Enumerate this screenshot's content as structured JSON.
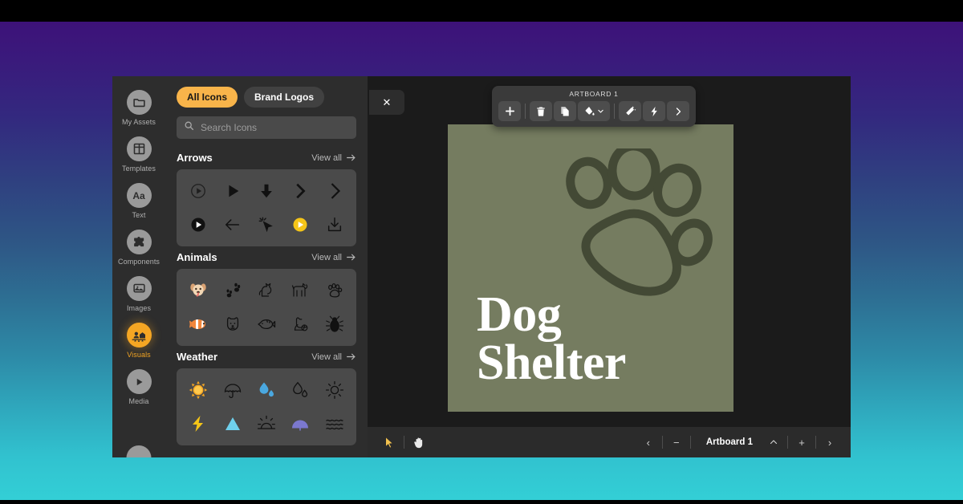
{
  "backdrop": {
    "gradient_top": "#3d1279",
    "gradient_bottom": "#33cfd6",
    "letterbox_color": "#000000"
  },
  "sidebar": {
    "items": [
      {
        "label": "My Assets",
        "icon": "folder-icon",
        "active": false
      },
      {
        "label": "Templates",
        "icon": "grid-layout-icon",
        "active": false
      },
      {
        "label": "Text",
        "icon": "text-aa-icon",
        "active": false
      },
      {
        "label": "Components",
        "icon": "puzzle-icon",
        "active": false
      },
      {
        "label": "Images",
        "icon": "image-icon",
        "active": false
      },
      {
        "label": "Visuals",
        "icon": "scene-icon",
        "active": true
      },
      {
        "label": "Media",
        "icon": "play-circle-icon",
        "active": false
      }
    ],
    "active_color": "#f5a623",
    "inactive_color": "#9a9a9a"
  },
  "panel": {
    "tabs": [
      {
        "label": "All Icons",
        "active": true
      },
      {
        "label": "Brand Logos",
        "active": false
      }
    ],
    "search": {
      "placeholder": "Search Icons",
      "value": "",
      "icon": "search-icon"
    },
    "close_label": "✕",
    "view_all_label": "View all",
    "sections": [
      {
        "title": "Arrows",
        "icons": [
          {
            "name": "play-circle-outline-icon",
            "glyph": "▷",
            "color": "#1a1a1a",
            "style": "outline"
          },
          {
            "name": "play-triangle-icon",
            "glyph": "▶",
            "color": "#111111",
            "style": "solid"
          },
          {
            "name": "arrow-down-bold-icon",
            "glyph": "⬇",
            "color": "#111111",
            "style": "solid"
          },
          {
            "name": "chevron-right-icon",
            "glyph": "›",
            "color": "#111111",
            "style": "solid"
          },
          {
            "name": "chevron-right-thin-icon",
            "glyph": "›",
            "color": "#111111",
            "style": "solid"
          },
          {
            "name": "play-circle-filled-icon",
            "glyph": "●",
            "color": "#111111",
            "style": "solid"
          },
          {
            "name": "arrow-left-icon",
            "glyph": "←",
            "color": "#111111",
            "style": "outline"
          },
          {
            "name": "click-cursor-icon",
            "glyph": "➤",
            "color": "#111111",
            "style": "outline"
          },
          {
            "name": "play-circle-yellow-icon",
            "glyph": "▶",
            "color": "#f5c518",
            "style": "solid"
          },
          {
            "name": "download-icon",
            "glyph": "⤓",
            "color": "#111111",
            "style": "outline"
          }
        ]
      },
      {
        "title": "Animals",
        "icons": [
          {
            "name": "dog-face-icon",
            "glyph": "🐶",
            "color": "#e8c39e",
            "style": "color"
          },
          {
            "name": "paw-prints-icon",
            "glyph": "🐾",
            "color": "#111111",
            "style": "solid"
          },
          {
            "name": "cat-outline-icon",
            "glyph": "🐈",
            "color": "#111111",
            "style": "outline"
          },
          {
            "name": "dog-outline-icon",
            "glyph": "🐕",
            "color": "#111111",
            "style": "outline"
          },
          {
            "name": "paw-print-icon",
            "glyph": "🐾",
            "color": "#111111",
            "style": "outline"
          },
          {
            "name": "clownfish-icon",
            "glyph": "🐠",
            "color": "#f29544",
            "style": "color"
          },
          {
            "name": "dog-head-icon",
            "glyph": "🐶",
            "color": "#111111",
            "style": "outline"
          },
          {
            "name": "fish-outline-icon",
            "glyph": "🐟",
            "color": "#111111",
            "style": "outline"
          },
          {
            "name": "dog-ball-icon",
            "glyph": "🐩",
            "color": "#111111",
            "style": "outline"
          },
          {
            "name": "bug-icon",
            "glyph": "🐞",
            "color": "#111111",
            "style": "solid"
          }
        ]
      },
      {
        "title": "Weather",
        "icons": [
          {
            "name": "sun-icon",
            "glyph": "☀",
            "color": "#f5a623",
            "style": "color"
          },
          {
            "name": "umbrella-icon",
            "glyph": "☂",
            "color": "#111111",
            "style": "outline"
          },
          {
            "name": "water-drops-icon",
            "glyph": "💧",
            "color": "#4aa8e0",
            "style": "color"
          },
          {
            "name": "drops-outline-icon",
            "glyph": "💧",
            "color": "#111111",
            "style": "outline"
          },
          {
            "name": "sun-outline-icon",
            "glyph": "☀",
            "color": "#111111",
            "style": "outline"
          },
          {
            "name": "lightning-bolt-icon",
            "glyph": "⚡",
            "color": "#f5c518",
            "style": "color"
          },
          {
            "name": "mountain-icon",
            "glyph": "▲",
            "color": "#6fd0ec",
            "style": "color"
          },
          {
            "name": "sunrise-icon",
            "glyph": "☀",
            "color": "#111111",
            "style": "outline"
          },
          {
            "name": "umbrella-purple-icon",
            "glyph": "☂",
            "color": "#7b78cf",
            "style": "color"
          },
          {
            "name": "waves-icon",
            "glyph": "≋",
            "color": "#111111",
            "style": "outline"
          }
        ]
      }
    ]
  },
  "artboard_toolbar": {
    "title": "ARTBOARD 1",
    "buttons": [
      {
        "name": "add-artboard-button",
        "icon": "plus-icon",
        "label": "+"
      },
      {
        "name": "delete-artboard-button",
        "icon": "trash-icon",
        "label": ""
      },
      {
        "name": "duplicate-button",
        "icon": "copy-icon",
        "label": ""
      },
      {
        "name": "fill-color-button",
        "icon": "paint-bucket-icon",
        "label": ""
      },
      {
        "name": "magic-effects-button",
        "icon": "magic-wand-icon",
        "label": ""
      },
      {
        "name": "animate-button",
        "icon": "lightning-icon",
        "label": ""
      },
      {
        "name": "more-options-button",
        "icon": "chevron-right-icon",
        "label": "›"
      }
    ]
  },
  "canvas": {
    "artboard": {
      "background_color": "#757c60",
      "logo": {
        "name": "paw-print-logo",
        "stroke_color": "#434935"
      },
      "headline_line1": "Dog",
      "headline_line2": "Shelter",
      "headline_color": "#ffffff"
    }
  },
  "status_bar": {
    "tools": [
      {
        "name": "select-tool",
        "icon": "cursor-arrow-icon",
        "active": true
      },
      {
        "name": "hand-tool",
        "icon": "hand-icon",
        "active": false
      }
    ],
    "prev_label": "‹",
    "zoom_out_label": "−",
    "artboard_name": "Artboard 1",
    "collapse_label": "⌃",
    "zoom_in_label": "+",
    "next_label": "›"
  }
}
